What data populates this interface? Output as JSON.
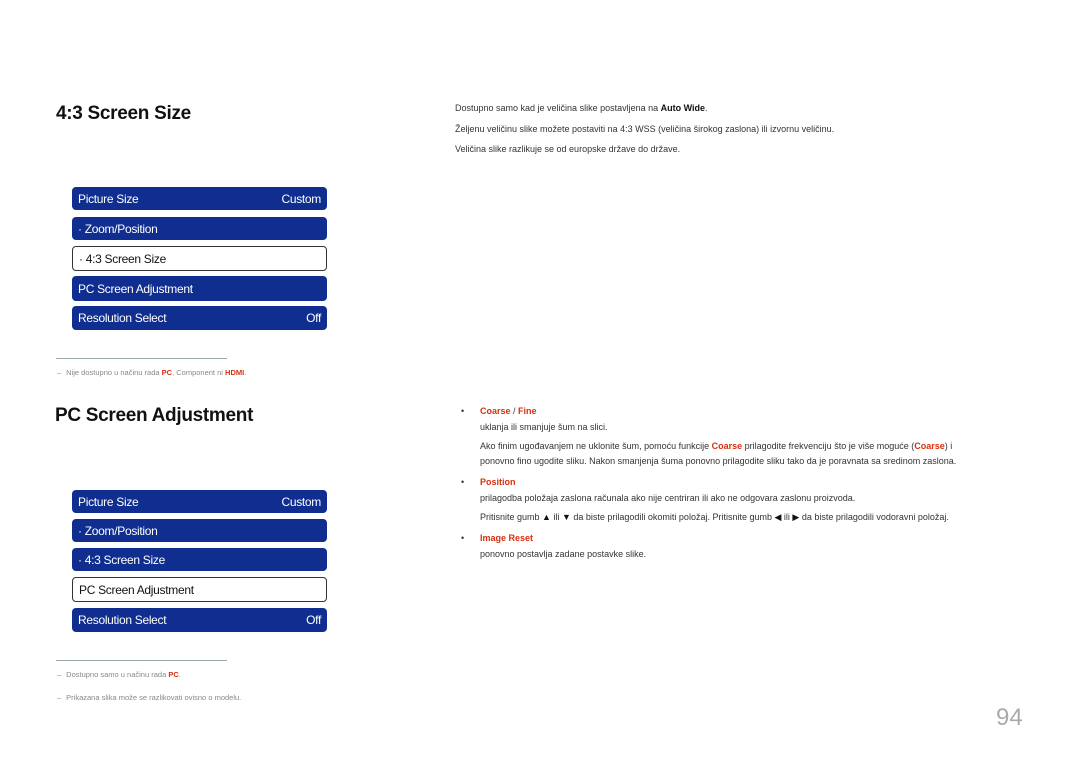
{
  "section1": {
    "title": "4:3 Screen Size",
    "intro": {
      "line1_pre": "Dostupno samo kad je veličina slike postavljena na ",
      "line1_bold": "Auto Wide",
      "line1_post": ".",
      "line2": "Željenu veličinu slike možete postaviti na 4:3 WSS (veličina širokog zaslona) ili izvornu veličinu.",
      "line3": "Veličina slike razlikuje se od europske države do države."
    },
    "menu": [
      {
        "label": "Picture Size",
        "value": "Custom",
        "selected": false
      },
      {
        "label": "· Zoom/Position",
        "value": "",
        "selected": false
      },
      {
        "label": "· 4:3 Screen Size",
        "value": "",
        "selected": true
      },
      {
        "label": "PC Screen Adjustment",
        "value": "",
        "selected": false
      },
      {
        "label": "Resolution Select",
        "value": "Off",
        "selected": false
      }
    ],
    "note": {
      "dash": "–",
      "pre": "Nije dostupno u načinu rada ",
      "hl1": "PC",
      "mid": ", Component ni ",
      "hl2": "HDMI",
      "post": "."
    }
  },
  "section2": {
    "title": "PC Screen Adjustment",
    "menu": [
      {
        "label": "Picture Size",
        "value": "Custom",
        "selected": false
      },
      {
        "label": "· Zoom/Position",
        "value": "",
        "selected": false
      },
      {
        "label": "· 4:3 Screen Size",
        "value": "",
        "selected": false
      },
      {
        "label": "PC Screen Adjustment",
        "value": "",
        "selected": true
      },
      {
        "label": "Resolution Select",
        "value": "Off",
        "selected": false
      }
    ],
    "items": [
      {
        "bullet": "•",
        "head1": "Coarse",
        "sep": " / ",
        "head2": "Fine",
        "desc": "uklanja ili smanjuje šum na slici.",
        "p1_a": "Ako finim ugođavanjem ne uklonite šum, pomoću funkcije ",
        "p1_b": "Coarse",
        "p1_c": " prilagodite frekvenciju što je više moguće (",
        "p1_d": "Coarse",
        "p1_e": ") i",
        "p2": "ponovno fino ugodite sliku. Nakon smanjenja šuma ponovno prilagodite sliku tako da je poravnata sa sredinom zaslona."
      },
      {
        "bullet": "•",
        "head": "Position",
        "desc": "prilagodba položaja zaslona računala ako nije centriran ili ako ne odgovara zaslonu proizvoda.",
        "p_a": "Pritisnite gumb ",
        "up": "▲",
        "p_b": " ili ",
        "down": "▼",
        "p_c": " da biste prilagodili okomiti položaj. Pritisnite gumb ",
        "left": "◀",
        "p_d": " ili ",
        "right": "▶",
        "p_e": " da biste prilagodili vodoravni položaj."
      },
      {
        "bullet": "•",
        "head": "Image Reset",
        "desc": "ponovno postavlja zadane postavke slike."
      }
    ],
    "notes": [
      {
        "dash": "–",
        "pre": "Dostupno samo u načinu rada ",
        "hl": "PC",
        "post": "."
      },
      {
        "dash": "–",
        "text": "Prikazana slika može se razlikovati ovisno o modelu."
      }
    ]
  },
  "page_number": "94"
}
